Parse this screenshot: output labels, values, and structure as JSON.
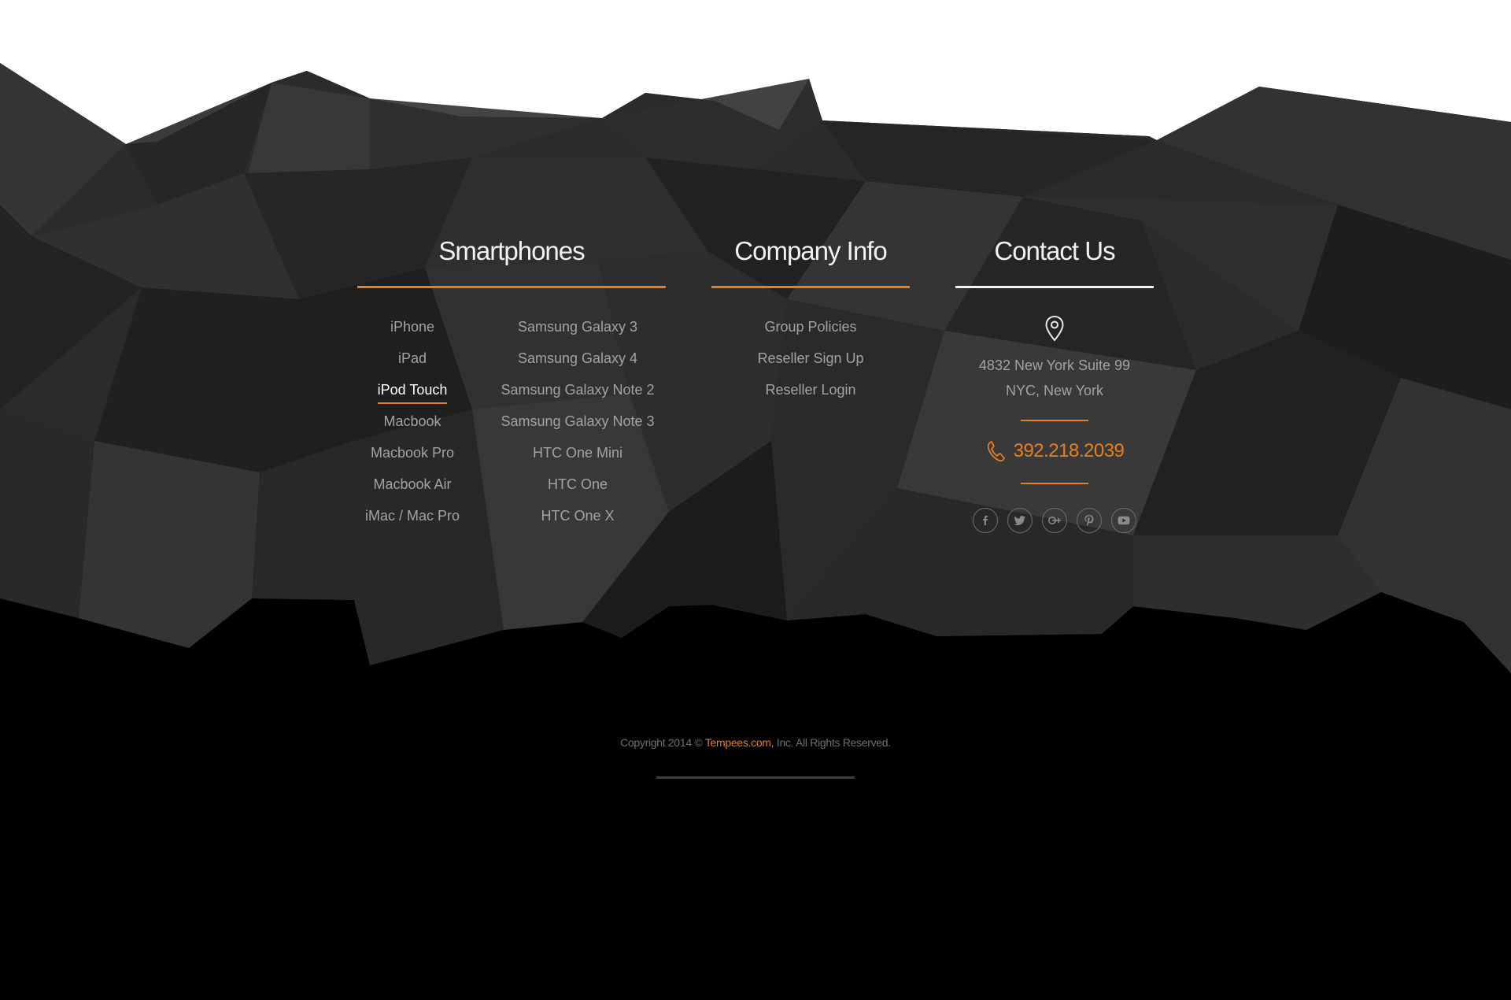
{
  "colors": {
    "accent": "#e67e22",
    "contact_rule": "#f2f2f2",
    "text_muted": "#a3a3a3",
    "background_band": "#2b2b2b",
    "page_bottom": "#000000"
  },
  "smartphones": {
    "heading": "Smartphones",
    "col1": [
      "iPhone",
      "iPad",
      "iPod Touch",
      "Macbook",
      "Macbook Pro",
      "Macbook Air",
      "iMac / Mac Pro"
    ],
    "col2": [
      "Samsung Galaxy 3",
      "Samsung Galaxy 4",
      "Samsung Galaxy Note 2",
      "Samsung Galaxy Note 3",
      "HTC One Mini",
      "HTC One",
      "HTC One X"
    ],
    "active_item": "iPod Touch"
  },
  "company": {
    "heading": "Company Info",
    "links": [
      "Group Policies",
      "Reseller Sign Up",
      "Reseller Login"
    ]
  },
  "contact": {
    "heading": "Contact Us",
    "address_line1": "4832 New York Suite 99",
    "address_line2": "NYC, New York",
    "phone": "392.218.2039",
    "icons": [
      "location-pin-icon",
      "phone-icon"
    ],
    "social": [
      "facebook-icon",
      "twitter-icon",
      "google-plus-icon",
      "pinterest-icon",
      "youtube-icon"
    ]
  },
  "copyright": {
    "prefix": "Copyright 2014 © ",
    "brand": "Tempees.com,",
    "suffix": " Inc. All Rights Reserved."
  }
}
